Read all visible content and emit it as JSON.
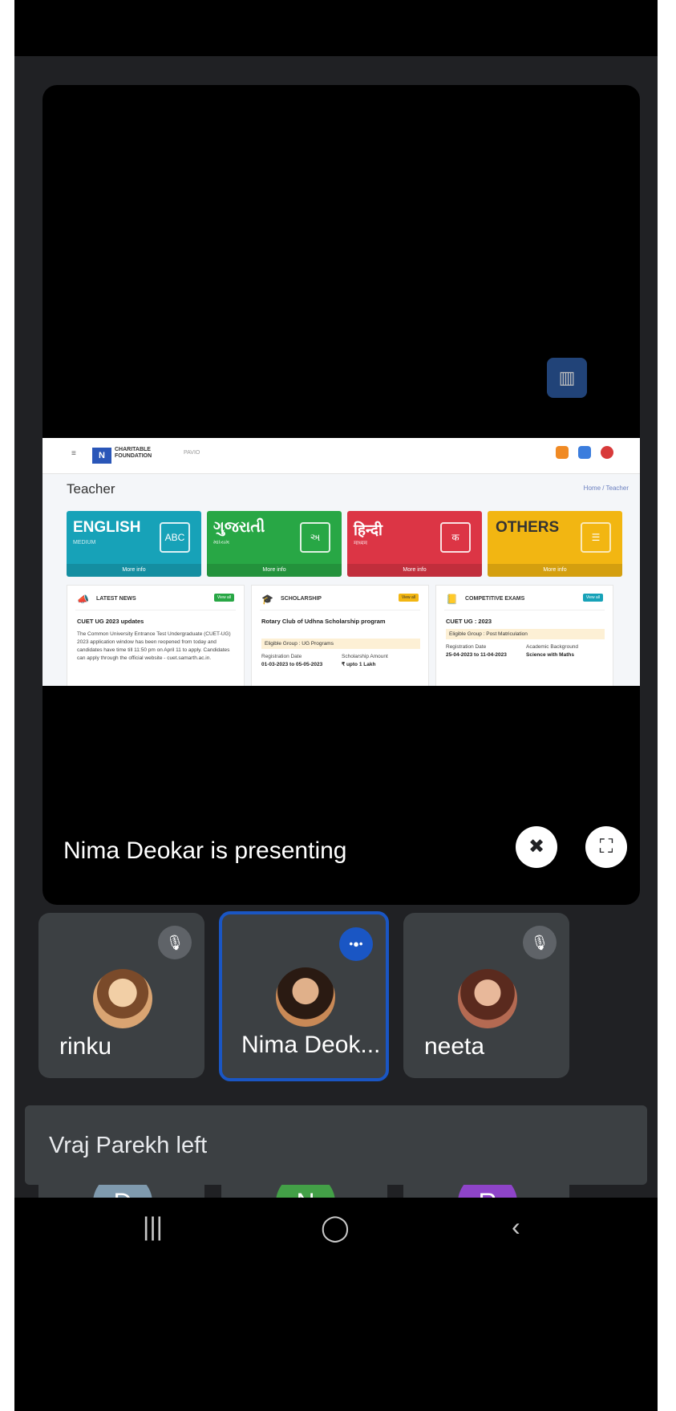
{
  "stage": {
    "presenting_text": "Nima Deokar is presenting",
    "pin_icon": "unpin-icon",
    "fullscreen_icon": "fullscreen-icon"
  },
  "shared_screen": {
    "logo_text": "CHARITABLE FOUNDATION",
    "search_text": "PAVIO",
    "breadcrumb": "Home / Teacher",
    "page_title": "Teacher",
    "categories": [
      {
        "title": "ENGLISH",
        "subtitle": "MEDIUM",
        "footer": "More info",
        "color": "#17a2b8"
      },
      {
        "title": "ગુજરાતી",
        "subtitle": "માધ્યમ",
        "footer": "More info",
        "color": "#28a745"
      },
      {
        "title": "हिन्दी",
        "subtitle": "माध्यम",
        "footer": "More info",
        "color": "#dc3545"
      },
      {
        "title": "OTHERS",
        "subtitle": "",
        "footer": "More info",
        "color": "#f2b612"
      }
    ],
    "panels": {
      "news": {
        "title": "LATEST NEWS",
        "badge": "View all",
        "headline": "CUET UG 2023 updates",
        "body": "The Common University Entrance Test Undergraduate (CUET-UG) 2023 application window has been reopened from today and candidates have time till 11:50 pm on April 11 to apply. Candidates can apply through the official website - cuet.samarth.ac.in."
      },
      "scholarship": {
        "title": "SCHOLARSHIP",
        "badge": "View all",
        "headline": "Rotary Club of Udhna Scholarship program",
        "eligibility": "Eligible Group : UG Programs",
        "reg_label": "Registration Date",
        "reg_value": "01-03-2023 to 05-05-2023",
        "amt_label": "Scholarship Amount",
        "amt_value": "₹ upto 1 Lakh"
      },
      "exams": {
        "title": "COMPETITIVE EXAMS",
        "badge": "View all",
        "headline": "CUET UG : 2023",
        "eligibility": "Eligible Group : Post Matriculation",
        "reg_label": "Registration Date",
        "reg_value": "25-04-2023 to 11-04-2023",
        "bg_label": "Academic Background",
        "bg_value": "Science with Maths"
      }
    }
  },
  "participants": [
    {
      "name": "rinku",
      "avatar_letter": "",
      "avatar_color": "#d9a472",
      "mic": "mic-off-icon",
      "active": false
    },
    {
      "name": "Nima Deok...",
      "avatar_letter": "",
      "avatar_color": "#c98956",
      "mic": "speaking-icon",
      "active": true
    },
    {
      "name": "neeta",
      "avatar_letter": "",
      "avatar_color": "#b46a52",
      "mic": "mic-off-icon",
      "active": false
    },
    {
      "name": "",
      "avatar_letter": "D",
      "avatar_color": "#7f9aae",
      "mic": "mic-off-icon",
      "active": false
    },
    {
      "name": "",
      "avatar_letter": "N",
      "avatar_color": "#43a047",
      "mic": "mic-off-icon",
      "active": false
    },
    {
      "name": "",
      "avatar_letter": "R",
      "avatar_color": "#8e44c9",
      "mic": "mic-off-icon",
      "active": false
    }
  ],
  "toast": {
    "text": "Vraj Parekh left"
  },
  "navbar": {
    "recents": "|||",
    "home": "◯",
    "back": "‹"
  }
}
